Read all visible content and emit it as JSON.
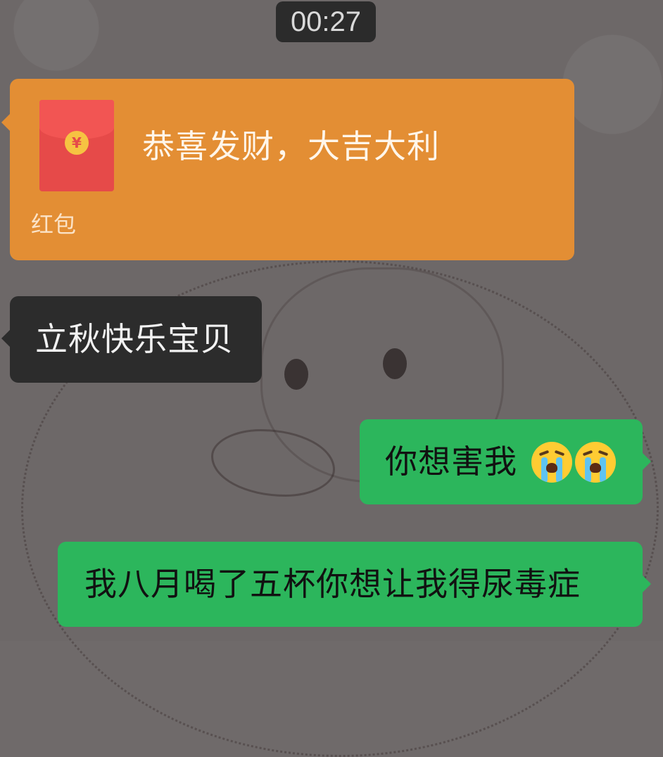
{
  "timestamp": "00:27",
  "red_packet": {
    "title": "恭喜发财，大吉大利",
    "coin_symbol": "¥",
    "footer_label": "红包",
    "color": "#e38e34"
  },
  "messages": [
    {
      "side": "received",
      "text": "立秋快乐宝贝"
    },
    {
      "side": "sent",
      "text": "你想害我",
      "emoji": [
        "loudly-crying-face",
        "loudly-crying-face"
      ]
    },
    {
      "side": "sent",
      "text": "我八月喝了五杯你想让我得尿毒症"
    }
  ],
  "colors": {
    "sent_bubble": "#2cb65c",
    "received_bubble": "#2c2c2c"
  }
}
